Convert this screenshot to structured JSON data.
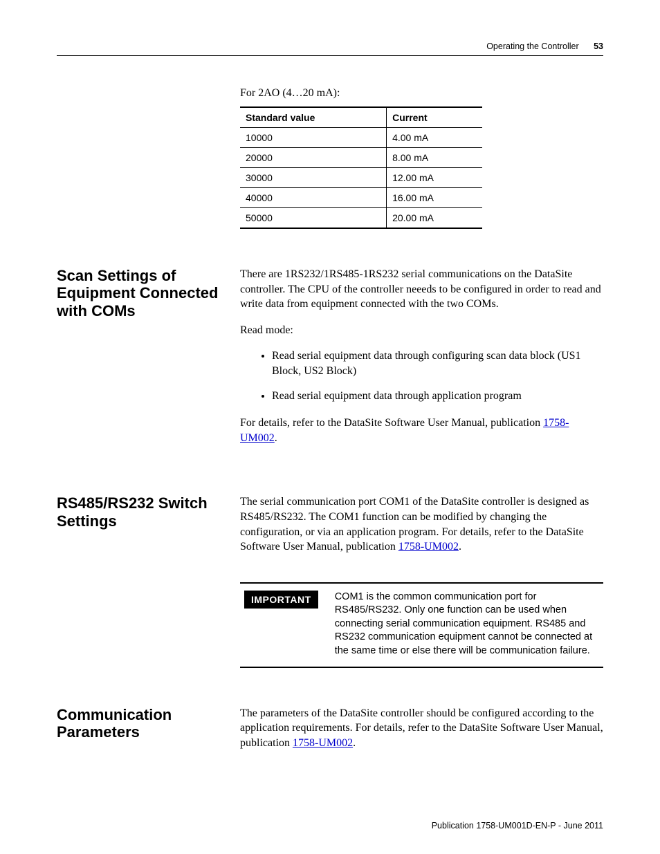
{
  "running_head": {
    "chapter": "Operating the Controller",
    "page_number": "53"
  },
  "top_caption": "For 2AO (4…20 mA):",
  "table": {
    "headers": [
      "Standard value",
      "Current"
    ],
    "rows": [
      [
        "10000",
        "4.00 mA"
      ],
      [
        "20000",
        "8.00 mA"
      ],
      [
        "30000",
        "12.00 mA"
      ],
      [
        "40000",
        "16.00 mA"
      ],
      [
        "50000",
        "20.00 mA"
      ]
    ]
  },
  "sections": {
    "scan": {
      "heading": "Scan Settings of Equipment Connected with COMs",
      "p1": "There are 1RS232/1RS485-1RS232 serial communications on the DataSite controller. The CPU of the controller neeeds to be configured in order to read and write data from equipment connected with the two COMs.",
      "p2": "Read mode:",
      "bullets": [
        "Read serial equipment data through configuring scan data block (US1 Block, US2 Block)",
        "Read serial equipment data through application program"
      ],
      "p3_pre": "For details, refer to the DataSite Software User Manual, publication ",
      "p3_link": "1758-UM002",
      "p3_post": "."
    },
    "switch": {
      "heading": "RS485/RS232 Switch Settings",
      "p1_pre": "The serial communication port COM1 of the DataSite controller is designed as RS485/RS232. The COM1 function can be modified by changing the configuration, or via an application program. For details, refer to the DataSite Software User Manual, publication ",
      "p1_link": "1758-UM002",
      "p1_post": "."
    },
    "comm": {
      "heading": "Communication Parameters",
      "p1_pre": "The parameters of the DataSite controller should be configured according to the application requirements. For details, refer to the DataSite Software User Manual, publication ",
      "p1_link": "1758-UM002",
      "p1_post": "."
    }
  },
  "important": {
    "label": "IMPORTANT",
    "text": "COM1 is the common communication port for RS485/RS232. Only one function can be used when connecting serial communication equipment. RS485 and RS232 communication equipment cannot be connected at the same time or else there will be communication failure."
  },
  "footer": "Publication 1758-UM001D-EN-P - June 2011"
}
